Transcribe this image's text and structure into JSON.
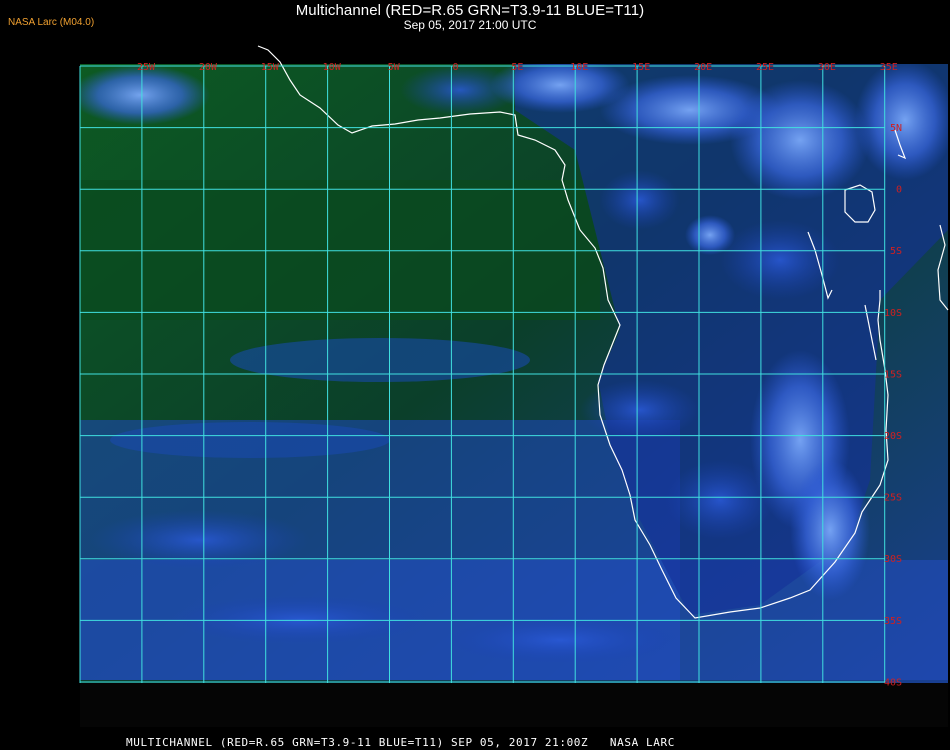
{
  "header": {
    "title": "Multichannel (RED=R.65 GRN=T3.9-11 BLUE=T11)",
    "datetime": "Sep 05, 2017 21:00 UTC",
    "source": "NASA Larc (M04.0)"
  },
  "footer": {
    "caption": "MULTICHANNEL (RED=R.65 GRN=T3.9-11 BLUE=T11) SEP 05, 2017 21:00Z   NASA LARC"
  },
  "map": {
    "longitude_labels": [
      "25W",
      "20W",
      "15W",
      "10W",
      "5W",
      "0",
      "5E",
      "10E",
      "15E",
      "20E",
      "25E",
      "30E",
      "35E"
    ],
    "latitude_labels": [
      "5N",
      "0",
      "5S",
      "10S",
      "15S",
      "20S",
      "25S",
      "30S",
      "35S",
      "40S"
    ],
    "colors": {
      "grid": "#40e0e0",
      "coast": "#ffffff",
      "labels": "#d02020",
      "ocean_clear": "#0a4a1a",
      "cloud": "#2a58d8",
      "cloud_bright": "#6a98f0"
    }
  }
}
